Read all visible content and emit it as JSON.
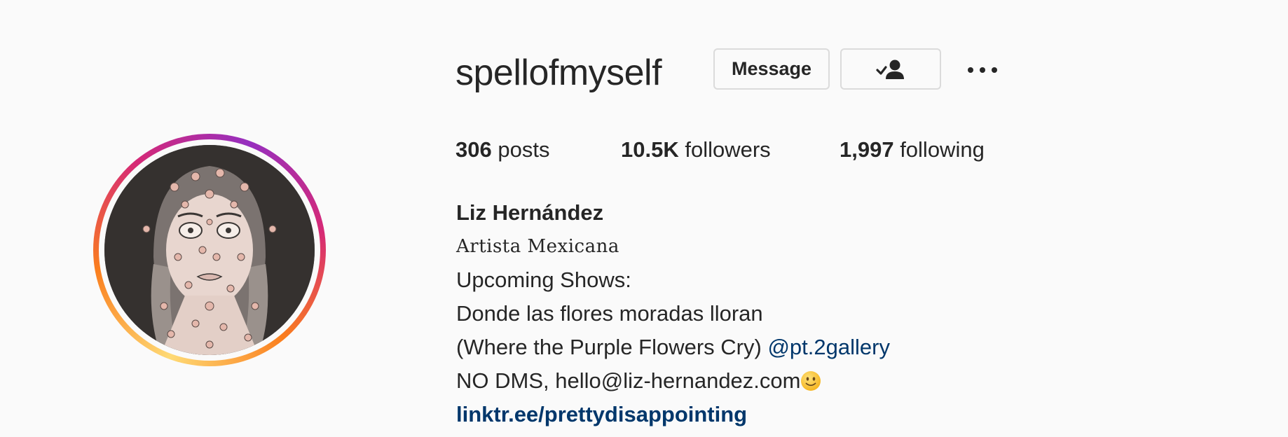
{
  "profile": {
    "username": "spellofmyself",
    "message_label": "Message",
    "follow_icon": "person-check-icon",
    "more_icon": "more-horizontal-icon"
  },
  "stats": {
    "posts_count": "306",
    "posts_label": " posts",
    "followers_count": "10.5K",
    "followers_label": " followers",
    "following_count": "1,997",
    "following_label": " following"
  },
  "bio": {
    "name": "Liz Hernández",
    "tagline": "Artista Mexicana",
    "line1": "Upcoming Shows:",
    "line2": "Donde las flores moradas lloran",
    "line3_text": "(Where the Purple Flowers Cry) ",
    "line3_mention": "@pt.2gallery",
    "line4": "NO DMS, hello@liz-hernandez.com",
    "link": "linktr.ee/prettydisappointing"
  },
  "colors": {
    "link": "#00376b",
    "text": "#262626",
    "border": "#dbdbdb",
    "background": "#fafafa"
  }
}
